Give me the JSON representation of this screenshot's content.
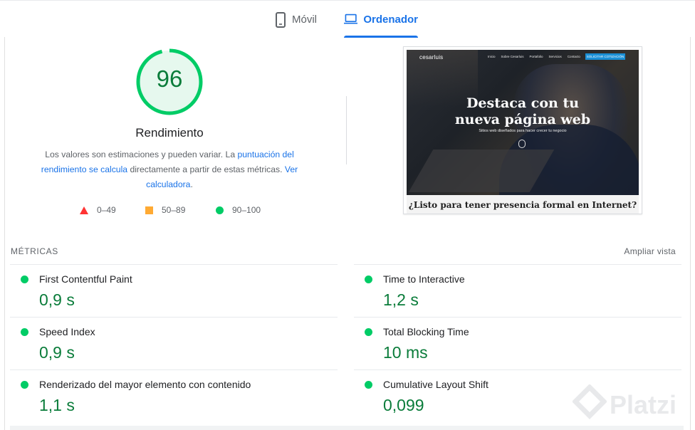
{
  "tabs": {
    "mobile": "Móvil",
    "desktop": "Ordenador"
  },
  "gauge": {
    "score": "96",
    "score_value": 96,
    "title": "Rendimiento",
    "description_before": "Los valores son estimaciones y pueden variar. La ",
    "description_link1": "puntuación del rendimiento se calcula",
    "description_middle": " directamente a partir de estas métricas. ",
    "description_link2": "Ver calculadora",
    "description_end": "."
  },
  "legend": {
    "fail": "0–49",
    "average": "50–89",
    "pass": "90–100"
  },
  "preview": {
    "logo": "cesarluis",
    "nav": [
      "Inicio",
      "Sobre Cesarluis",
      "Portafolio",
      "Servicios",
      "Contacto"
    ],
    "cta": "SOLICITAR COTIZACIÓN",
    "headline_line1": "Destaca con tu",
    "headline_line2": "nueva página web",
    "subheadline": "Sitios web diseñados para hacer crecer tu negocio",
    "bottom": "¿Listo para tener presencia formal en Internet?"
  },
  "metrics": {
    "title": "MÉTRICAS",
    "expand": "Ampliar vista",
    "items": [
      {
        "name": "First Contentful Paint",
        "value": "0,9 s"
      },
      {
        "name": "Time to Interactive",
        "value": "1,2 s"
      },
      {
        "name": "Speed Index",
        "value": "0,9 s"
      },
      {
        "name": "Total Blocking Time",
        "value": "10 ms"
      },
      {
        "name": "Renderizado del mayor elemento con contenido",
        "value": "1,1 s"
      },
      {
        "name": "Cumulative Layout Shift",
        "value": "0,099"
      }
    ]
  },
  "watermark": "Platzi",
  "colors": {
    "pass": "#00cc66",
    "pass_text": "#0a7c3a",
    "average": "#ffaa33",
    "fail": "#ff3333",
    "accent": "#1a73e8"
  }
}
